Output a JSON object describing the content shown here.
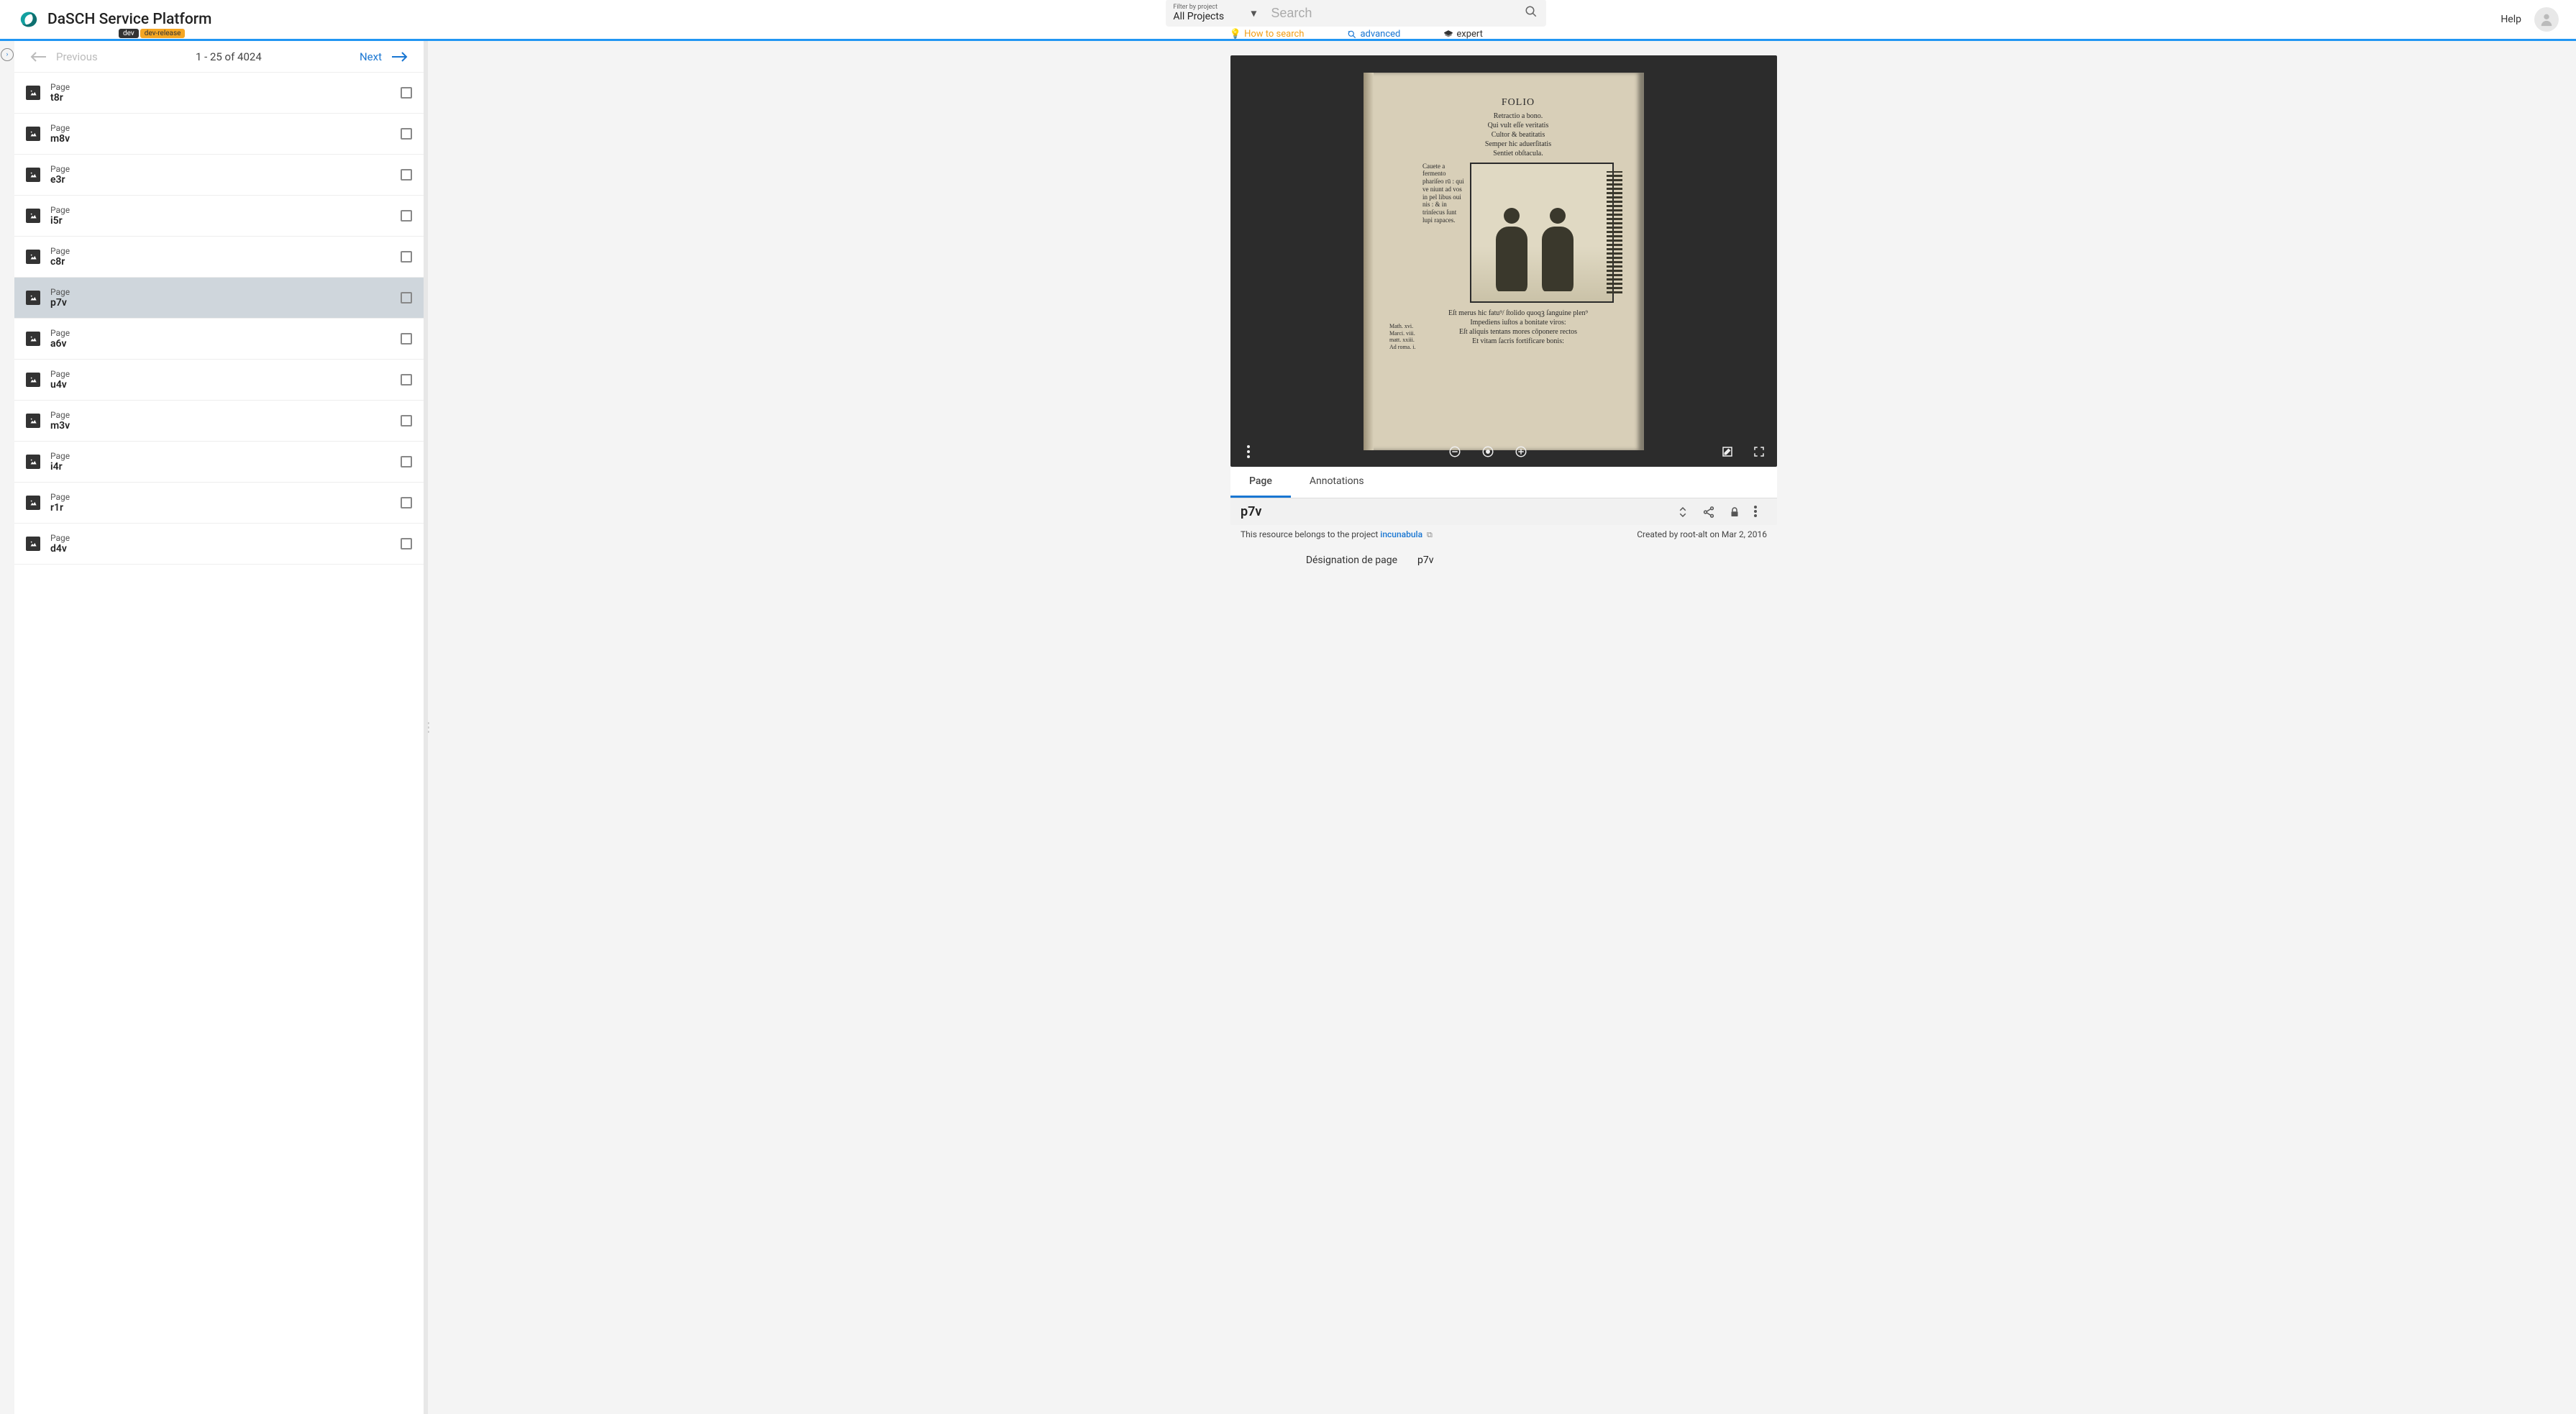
{
  "header": {
    "brand": "DaSCH Service Platform",
    "badge_dev": "dev",
    "badge_release": "dev-release",
    "filter_label": "Filter by project",
    "filter_value": "All Projects",
    "search_placeholder": "Search",
    "hint_how": "How to search",
    "hint_advanced": "advanced",
    "hint_expert": "expert",
    "help": "Help"
  },
  "pager": {
    "prev": "Previous",
    "range": "1 - 25 of 4024",
    "next": "Next"
  },
  "results": [
    {
      "type": "Page",
      "name": "t8r"
    },
    {
      "type": "Page",
      "name": "m8v"
    },
    {
      "type": "Page",
      "name": "e3r"
    },
    {
      "type": "Page",
      "name": "i5r"
    },
    {
      "type": "Page",
      "name": "c8r"
    },
    {
      "type": "Page",
      "name": "p7v"
    },
    {
      "type": "Page",
      "name": "a6v"
    },
    {
      "type": "Page",
      "name": "u4v"
    },
    {
      "type": "Page",
      "name": "m3v"
    },
    {
      "type": "Page",
      "name": "i4r"
    },
    {
      "type": "Page",
      "name": "r1r"
    },
    {
      "type": "Page",
      "name": "d4v"
    }
  ],
  "selected_index": 5,
  "viewer": {
    "manuscript": {
      "header": "FOLIO",
      "top_lines": "Retractio a bono.\nQui vult eſſe veritatis\nCultor & beatitatis\nSemper hic aduerſitatis\nSentiet obſtacula.",
      "side_text": "Cauete a fermento phariſeo rū : qui ve niunt ad vos in pel libus oui nis : & in trinſecus ſunt lupi rapaces.",
      "bottom_lines": "Eſt merus hic fatu⁹/ ſtolido quoqꝫ ſanguine plen⁹\nImpediens iuſtos a bonitate viros:\nEſt aliquis tentans mores cōponere rectos\nEt vitam ſacris fortificare bonis:",
      "margin_refs": "Math. xvi.\nMarci. viii.\nmatt. xxiii.\nAd roma. i."
    },
    "tabs": {
      "page": "Page",
      "annotations": "Annotations"
    },
    "title": "p7v",
    "belongs_prefix": "This resource belongs to the project ",
    "project_name": "incunabula",
    "created_by": "Created by root-alt on Mar 2, 2016",
    "props": {
      "designation_label": "Désignation de page",
      "designation_value": "p7v"
    }
  }
}
